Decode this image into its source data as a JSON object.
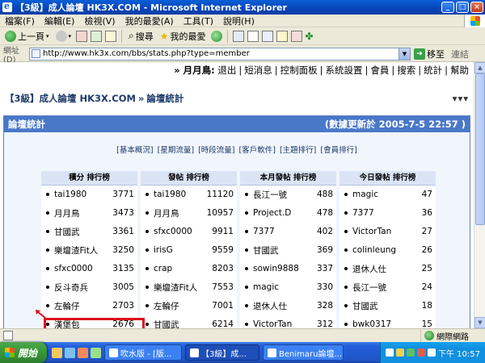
{
  "window": {
    "title": "【3級】成人論壇 HK3X.COM - Microsoft Internet Explorer",
    "buttons": [
      "_",
      "□",
      "×"
    ]
  },
  "menubar": [
    "檔案(F)",
    "編輯(E)",
    "檢視(V)",
    "我的最愛(A)",
    "工具(T)",
    "說明(H)"
  ],
  "toolbar": {
    "back": "上一頁",
    "search": "搜尋",
    "favorites": "我的最愛"
  },
  "address": {
    "label": "網址(D)",
    "url": "http://www.hk3x.com/bbs/stats.php?type=member",
    "go": "移至",
    "links": "連結"
  },
  "topnav": {
    "user": "» 月月鳥:",
    "links": [
      "退出",
      "短消息",
      "控制面板",
      "系統設置",
      "會員",
      "搜索",
      "統計",
      "幫助"
    ]
  },
  "breadcrumb": {
    "forum": "【3級】成人論壇 HK3X.COM",
    "arrow": "»",
    "page": "論壇統計",
    "more": "▾▾▾"
  },
  "panel": {
    "title": "論壇統計",
    "updated": "(數據更新於 2005-7-5 22:57 )"
  },
  "tabs": [
    "[基本概況]",
    "[星期流量]",
    "[時段流量]",
    "[客戶軟件]",
    "[主題排行]",
    "[會員排行]"
  ],
  "rankings": [
    {
      "header": "積分 排行榜",
      "rows": [
        {
          "name": "tai1980",
          "value": "3771"
        },
        {
          "name": "月月鳥",
          "value": "3473"
        },
        {
          "name": "甘國武",
          "value": "3361"
        },
        {
          "name": "樂壇渣Fit人",
          "value": "3250"
        },
        {
          "name": "sfxc0000",
          "value": "3135"
        },
        {
          "name": "反斗奇兵",
          "value": "3005"
        },
        {
          "name": "左輪仔",
          "value": "2703"
        },
        {
          "name": "漢堡包",
          "value": "2676"
        }
      ]
    },
    {
      "header": "發帖 排行榜",
      "rows": [
        {
          "name": "tai1980",
          "value": "11120"
        },
        {
          "name": "月月鳥",
          "value": "10957"
        },
        {
          "name": "sfxc0000",
          "value": "9911"
        },
        {
          "name": "irisG",
          "value": "9559"
        },
        {
          "name": "crap",
          "value": "8203"
        },
        {
          "name": "樂壇渣Fit人",
          "value": "7553"
        },
        {
          "name": "左輪仔",
          "value": "7001"
        },
        {
          "name": "甘國武",
          "value": "6214"
        }
      ]
    },
    {
      "header": "本月發帖 排行榜",
      "rows": [
        {
          "name": "長江一號",
          "value": "488"
        },
        {
          "name": "Project.D",
          "value": "478"
        },
        {
          "name": "7377",
          "value": "402"
        },
        {
          "name": "甘國武",
          "value": "369"
        },
        {
          "name": "sowin9888",
          "value": "337"
        },
        {
          "name": "magic",
          "value": "330"
        },
        {
          "name": "退休人仕",
          "value": "328"
        },
        {
          "name": "VictorTan",
          "value": "312"
        }
      ]
    },
    {
      "header": "今日發帖 排行榜",
      "rows": [
        {
          "name": "magic",
          "value": "47"
        },
        {
          "name": "7377",
          "value": "36"
        },
        {
          "name": "VictorTan",
          "value": "27"
        },
        {
          "name": "colinleung",
          "value": "26"
        },
        {
          "name": "退休人仕",
          "value": "25"
        },
        {
          "name": "長江一號",
          "value": "24"
        },
        {
          "name": "甘國武",
          "value": "18"
        },
        {
          "name": "bwk0317",
          "value": "15"
        }
      ]
    }
  ],
  "status": {
    "zone": "網際網路"
  },
  "taskbar": {
    "start": "開始",
    "tasks": [
      "吹水版 - [版...",
      "【3級】成...",
      "Benimaru論壇..."
    ],
    "clock": "下午 10:57"
  },
  "colors": {
    "panel_header": "#4a78c8",
    "highlight": "#e0101a",
    "taskbar": "#245edb"
  }
}
